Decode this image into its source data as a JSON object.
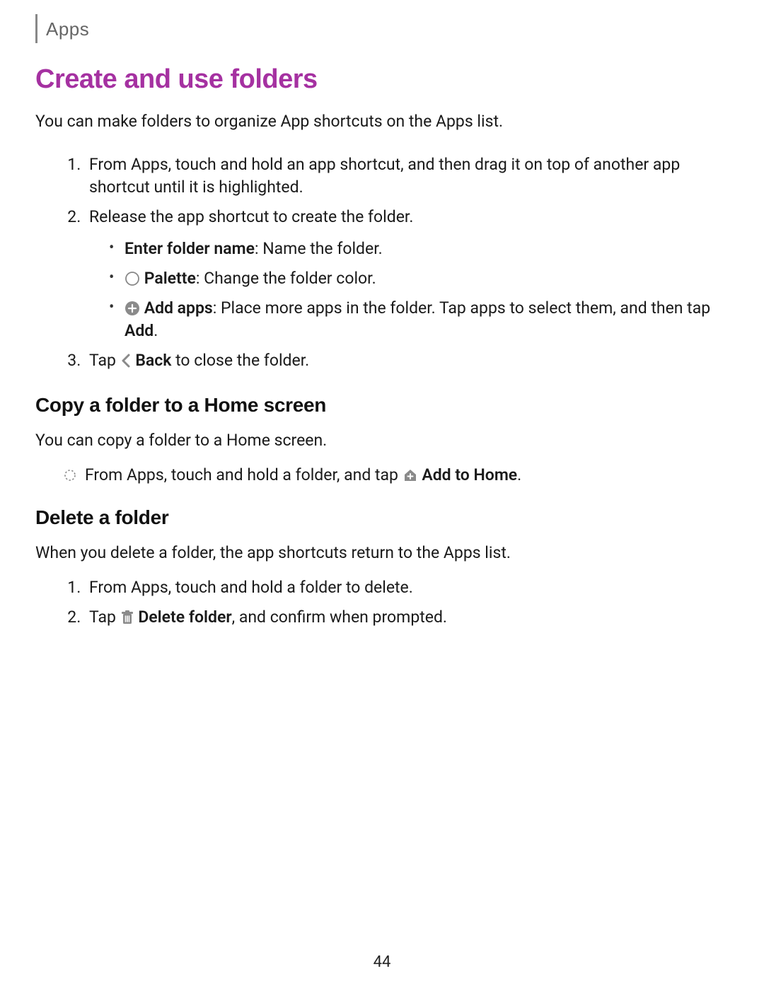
{
  "header": {
    "section": "Apps"
  },
  "title": "Create and use folders",
  "intro": "You can make folders to organize App shortcuts on the Apps list.",
  "step1": "From Apps, touch and hold an app shortcut, and then drag it on top of another app shortcut until it is highlighted.",
  "step2": "Release the app shortcut to create the folder.",
  "step2_sub": {
    "enter_name_bold": "Enter folder name",
    "enter_name_rest": ": Name the folder.",
    "palette_bold": "Palette",
    "palette_rest": ": Change the folder color.",
    "add_apps_bold": "Add apps",
    "add_apps_rest": ": Place more apps in the folder. Tap apps to select them, and then tap ",
    "add_apps_add": "Add",
    "add_apps_period": "."
  },
  "step3_tap": "Tap ",
  "step3_back": "Back",
  "step3_rest": " to close the folder.",
  "copy_h": "Copy a folder to a Home screen",
  "copy_intro": "You can copy a folder to a Home screen.",
  "copy_step_a": "From Apps, touch and hold a folder, and tap ",
  "copy_step_bold": "Add to Home",
  "copy_step_period": ".",
  "delete_h": "Delete a folder",
  "delete_intro": "When you delete a folder, the app shortcuts return to the Apps list.",
  "delete_step1": "From Apps, touch and hold a folder to delete.",
  "delete_step2_tap": "Tap ",
  "delete_step2_bold": "Delete folder",
  "delete_step2_rest": ", and confirm when prompted.",
  "page_number": "44"
}
